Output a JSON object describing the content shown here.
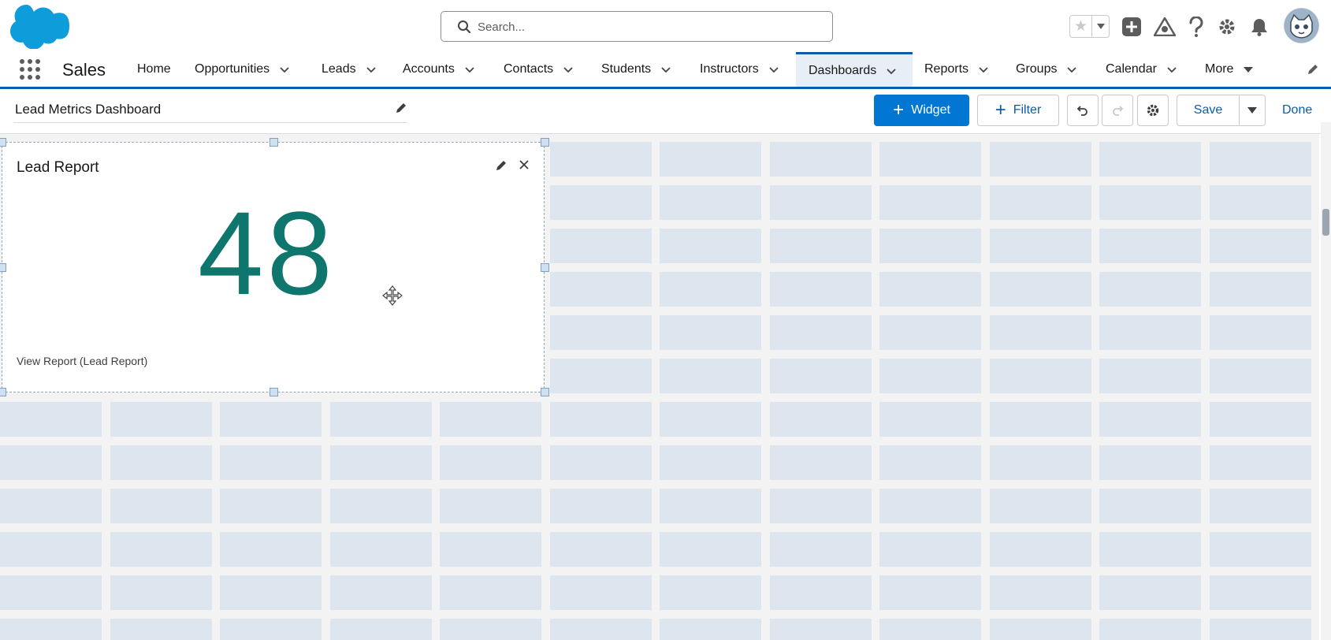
{
  "colors": {
    "brand": "#0176d3",
    "nav_accent": "#0b5cab",
    "metric": "#0f766e",
    "grid_cell": "#dde5ee"
  },
  "header": {
    "logo": "salesforce-cloud-logo",
    "search": {
      "placeholder": "Search..."
    },
    "icons": [
      "favorites-star-icon",
      "global-actions-add-icon",
      "trailhead-icon",
      "help-icon",
      "setup-gear-icon",
      "notifications-bell-icon",
      "user-avatar"
    ]
  },
  "nav": {
    "app_name": "Sales",
    "items": [
      {
        "label": "Home",
        "has_menu": false
      },
      {
        "label": "Opportunities",
        "has_menu": true
      },
      {
        "label": "Leads",
        "has_menu": true
      },
      {
        "label": "Accounts",
        "has_menu": true
      },
      {
        "label": "Contacts",
        "has_menu": true
      },
      {
        "label": "Students",
        "has_menu": true
      },
      {
        "label": "Instructors",
        "has_menu": true
      },
      {
        "label": "Dashboards",
        "has_menu": true,
        "active": true
      },
      {
        "label": "Reports",
        "has_menu": true
      },
      {
        "label": "Groups",
        "has_menu": true
      },
      {
        "label": "Calendar",
        "has_menu": true
      },
      {
        "label": "More",
        "has_menu": true
      }
    ]
  },
  "toolbar": {
    "dashboard_title": "Lead Metrics Dashboard",
    "widget_label": "Widget",
    "filter_label": "Filter",
    "save_label": "Save",
    "done_label": "Done"
  },
  "widget": {
    "title": "Lead Report",
    "metric_value": "48",
    "view_report_label": "View Report (Lead Report)"
  }
}
